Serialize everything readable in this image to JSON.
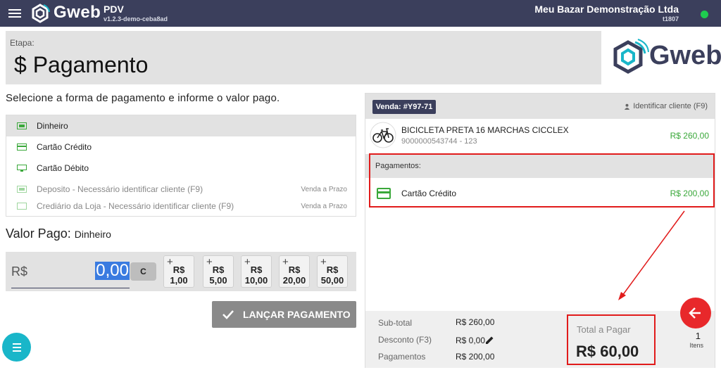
{
  "topbar": {
    "logo_text": "Gweb",
    "app_name": "PDV",
    "app_version": "v1.2.3-demo-ceba8ad",
    "store_name": "Meu Bazar Demonstração Ltda",
    "store_id": "t1807",
    "status_color": "#1ecb4f"
  },
  "stage": {
    "label": "Etapa:",
    "title": "$ Pagamento",
    "logo_text": "Gweb"
  },
  "instruction": "Selecione a forma de pagamento e informe o valor pago.",
  "methods": [
    {
      "label": "Dinheiro",
      "tag": "",
      "icon": "cash-icon",
      "active": true
    },
    {
      "label": "Cartão Crédito",
      "tag": "",
      "icon": "credit-card-icon"
    },
    {
      "label": "Cartão Débito",
      "tag": "",
      "icon": "debit-card-icon"
    },
    {
      "label": "Deposito - Necessário identificar cliente (F9)",
      "tag": "Venda a Prazo",
      "icon": "deposit-icon"
    },
    {
      "label": "Crediário da Loja - Necessário identificar cliente (F9)",
      "tag": "Venda a Prazo",
      "icon": "store-credit-icon"
    }
  ],
  "valor_pago": {
    "title": "Valor Pago:",
    "method": "Dinheiro",
    "currency": "R$",
    "value": "0,00",
    "clear_label": "C",
    "quick_buttons": [
      {
        "top": "R$",
        "bottom": "1,00"
      },
      {
        "top": "R$",
        "bottom": "5,00"
      },
      {
        "top": "R$",
        "bottom": "10,00"
      },
      {
        "top": "R$",
        "bottom": "20,00"
      },
      {
        "top": "R$",
        "bottom": "50,00"
      }
    ]
  },
  "launch_button": "LANÇAR PAGAMENTO",
  "sale": {
    "badge": "Venda: #Y97-71",
    "identify_label": "Identificar cliente (F9)",
    "item": {
      "name": "BICICLETA PRETA 16 MARCHAS CICCLEX",
      "code": "9000000543744 - 123",
      "price": "R$ 260,00"
    },
    "payments_label": "Pagamentos:",
    "payment": {
      "label": "Cartão Crédito",
      "value": "R$ 200,00"
    }
  },
  "totals": {
    "subtotal_label": "Sub-total",
    "subtotal_value": "R$ 260,00",
    "discount_label": "Desconto (F3)",
    "discount_value": "R$ 0,00",
    "payments_label": "Pagamentos",
    "payments_value": "R$ 200,00",
    "to_pay_label": "Total a Pagar",
    "to_pay_value": "R$ 60,00",
    "items_count": "1",
    "items_label": "Itens"
  },
  "colors": {
    "primary": "#3b3f5c",
    "positive": "#3aa83a",
    "highlight": "#e11b1b",
    "accent": "#19b6c9"
  }
}
